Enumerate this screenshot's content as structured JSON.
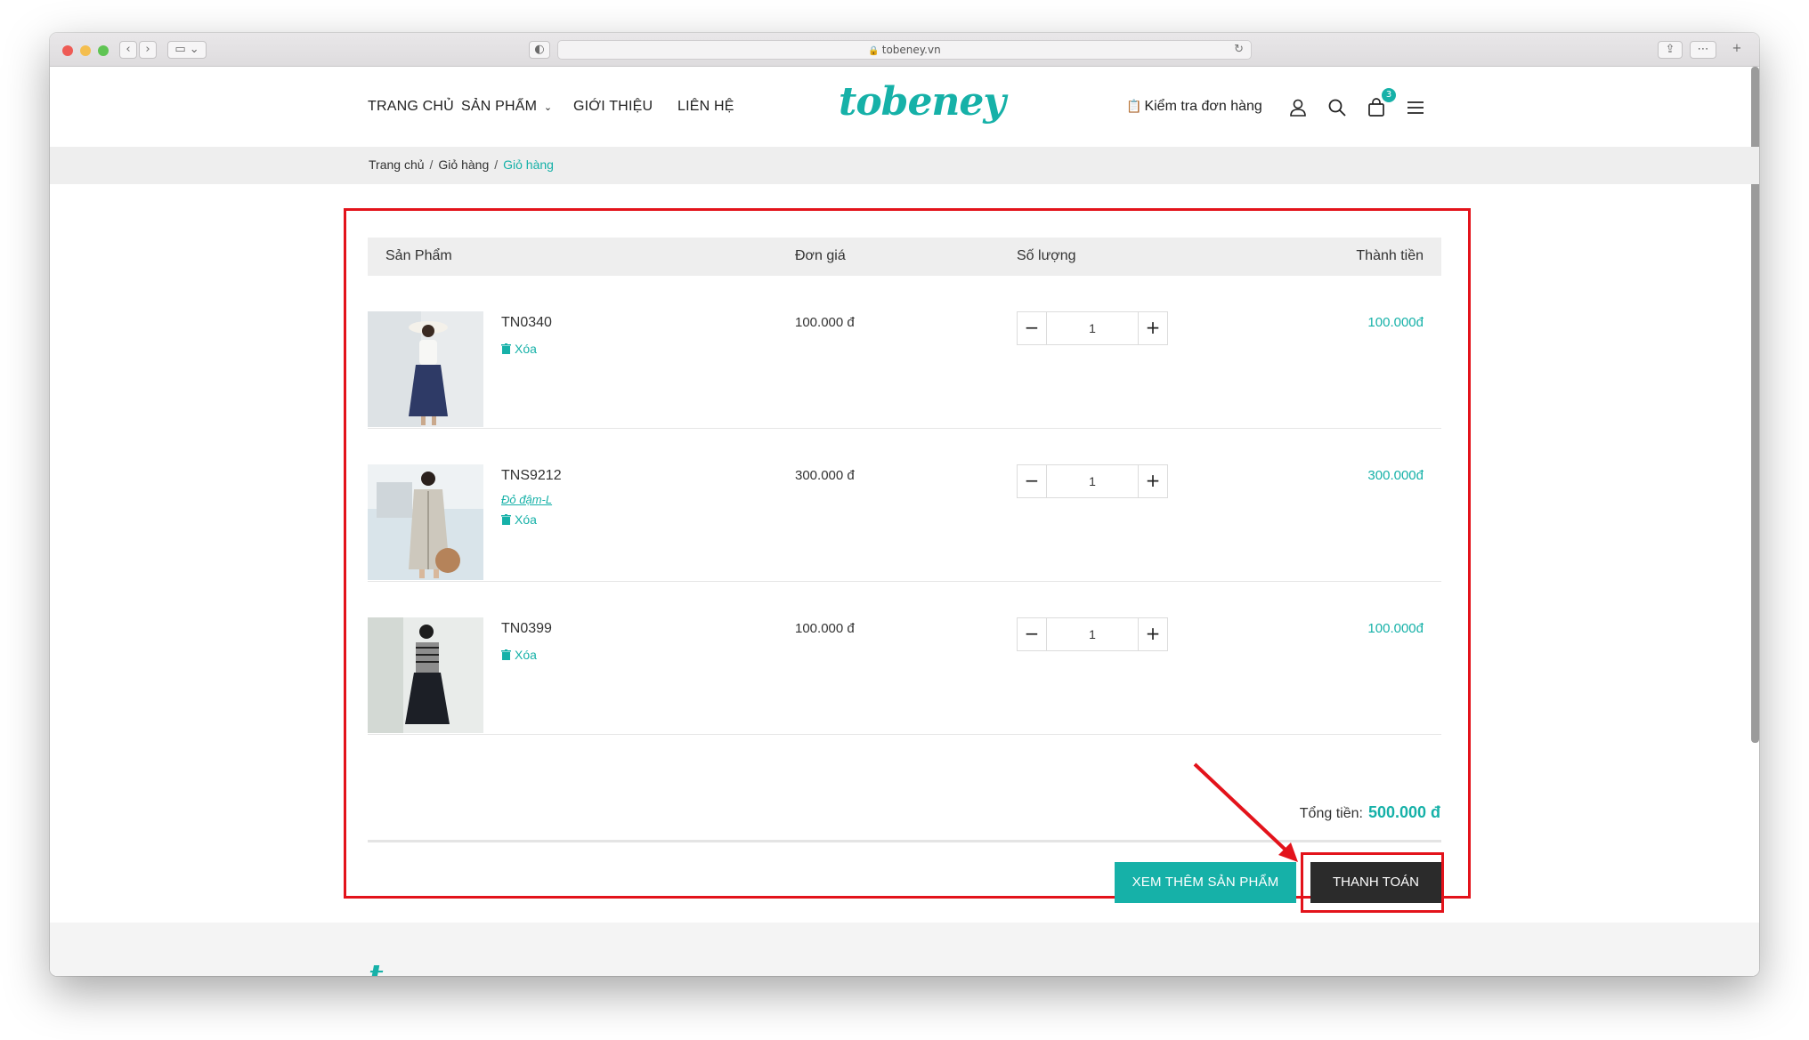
{
  "browser": {
    "url": "tobeney.vn"
  },
  "header": {
    "nav": [
      "TRANG CHỦ",
      "SẢN PHẨM",
      "GIỚI THIỆU",
      "LIÊN HỆ"
    ],
    "logo": "tobeney",
    "check_order": "Kiểm tra đơn hàng",
    "cart_count": "3"
  },
  "breadcrumb": {
    "home": "Trang chủ",
    "cart": "Giỏ hàng",
    "current": "Giỏ hàng"
  },
  "table": {
    "col_product": "Sản Phẩm",
    "col_price": "Đơn giá",
    "col_qty": "Số lượng",
    "col_total": "Thành tiền"
  },
  "items": [
    {
      "code": "TN0340",
      "variant": "",
      "delete_label": "Xóa",
      "price": "100.000 đ",
      "qty": "1",
      "total": "100.000đ"
    },
    {
      "code": "TNS9212",
      "variant": "Đỏ đậm-L",
      "delete_label": "Xóa",
      "price": "300.000 đ",
      "qty": "1",
      "total": "300.000đ"
    },
    {
      "code": "TN0399",
      "variant": "",
      "delete_label": "Xóa",
      "price": "100.000 đ",
      "qty": "1",
      "total": "100.000đ"
    }
  ],
  "summary": {
    "total_label": "Tổng tiền:",
    "total_value": "500.000 đ"
  },
  "buttons": {
    "more_products": "XEM THÊM SẢN PHẨM",
    "checkout": "THANH TOÁN"
  },
  "colors": {
    "accent": "#16b1a8",
    "highlight": "#e3131b",
    "dark_button": "#2b2b2b"
  }
}
